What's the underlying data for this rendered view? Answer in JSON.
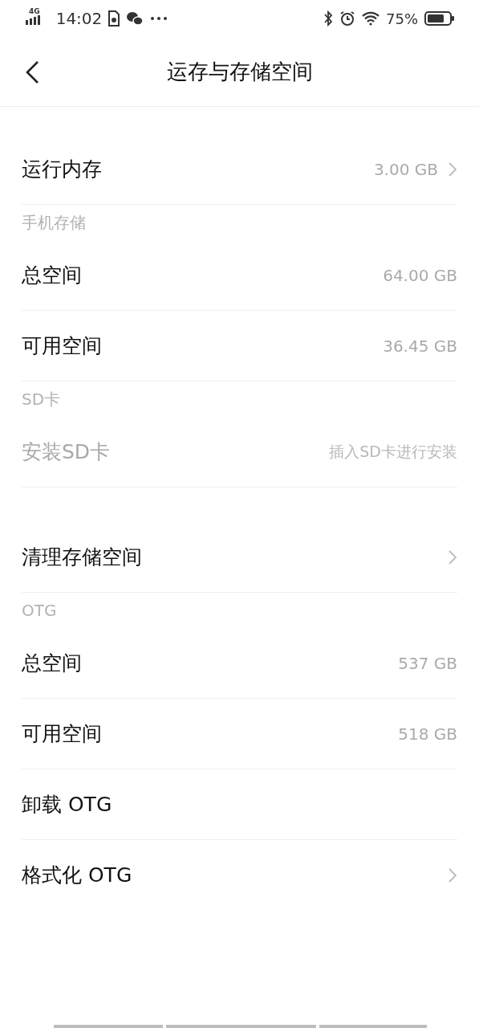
{
  "status_bar": {
    "network": "4G",
    "time": "14:02",
    "battery": "75%"
  },
  "header": {
    "title": "运存与存储空间"
  },
  "sections": [
    {
      "items": [
        {
          "kind": "row",
          "label": "运行内存",
          "value": "3.00 GB",
          "chevron": true,
          "disabled": false
        },
        {
          "kind": "header",
          "label": "手机存储"
        },
        {
          "kind": "row",
          "label": "总空间",
          "value": "64.00 GB",
          "chevron": false,
          "disabled": false
        },
        {
          "kind": "row",
          "label": "可用空间",
          "value": "36.45 GB",
          "chevron": false,
          "disabled": false
        },
        {
          "kind": "header",
          "label": "SD卡"
        },
        {
          "kind": "row",
          "label": "安装SD卡",
          "value": "插入SD卡进行安装",
          "chevron": false,
          "disabled": true
        }
      ]
    },
    {
      "items": [
        {
          "kind": "row",
          "label": "清理存储空间",
          "chevron": true,
          "disabled": false
        },
        {
          "kind": "header",
          "label": "OTG"
        },
        {
          "kind": "row",
          "label": "总空间",
          "value": "537 GB",
          "chevron": false,
          "disabled": false
        },
        {
          "kind": "row",
          "label": "可用空间",
          "value": "518 GB",
          "chevron": false,
          "disabled": false
        },
        {
          "kind": "row",
          "label": "卸载 OTG",
          "chevron": false,
          "disabled": false
        },
        {
          "kind": "row",
          "label": "格式化 OTG",
          "chevron": true,
          "disabled": false
        }
      ]
    }
  ]
}
